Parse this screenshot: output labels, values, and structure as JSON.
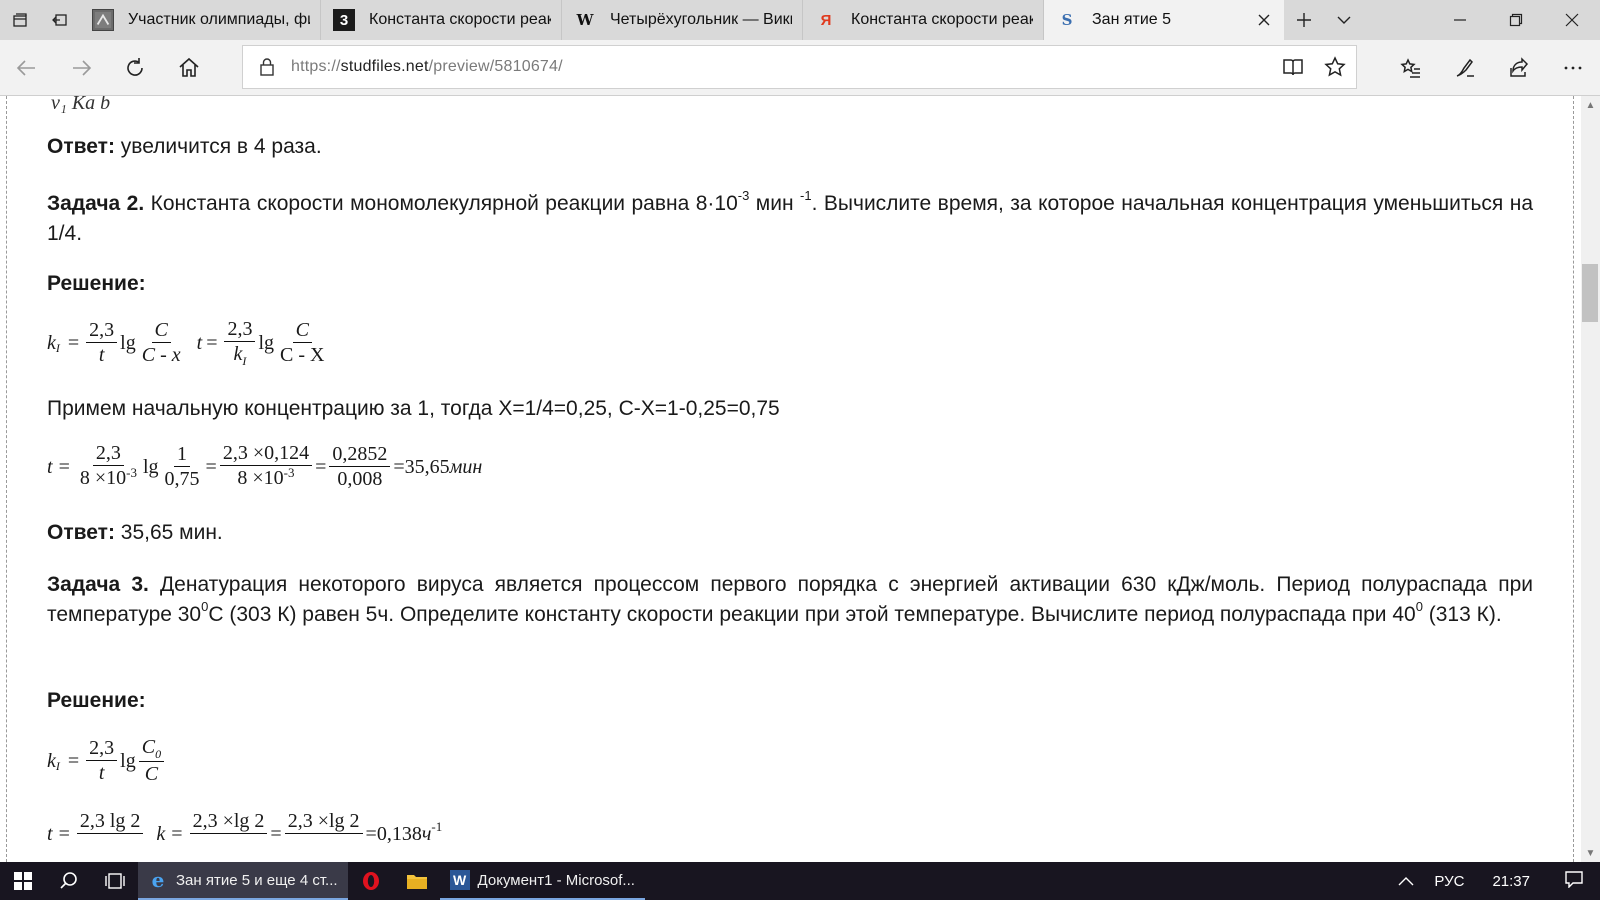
{
  "tabs": [
    {
      "title": "Участник олимпиады, фи",
      "icon": "olympiad-favicon-icon"
    },
    {
      "title": "Константа скорости реакі",
      "icon": "three-favicon-icon",
      "favicon_text": "3"
    },
    {
      "title": "Четырёхугольник — Вики",
      "icon": "wikipedia-favicon-icon",
      "favicon_text": "W"
    },
    {
      "title": "Константа скорости реакі",
      "icon": "yandex-favicon-icon",
      "favicon_text": "Я"
    },
    {
      "title": "Зан ятие 5",
      "icon": "studfiles-favicon-icon",
      "favicon_text": "S"
    }
  ],
  "address": {
    "scheme": "https://",
    "host": "studfiles.net",
    "path": "/preview/5810674/"
  },
  "doc": {
    "top_formula_fragment": "v₁      Ka  b",
    "answer1_label": "Ответ:",
    "answer1_text": " увеличится в 4 раза.",
    "task2_label": "Задача 2.",
    "task2_text_a": " Константа скорости мономолекулярной реакции равна 8·10",
    "task2_exp1": "-3",
    "task2_text_b": " мин ",
    "task2_exp2": "-1",
    "task2_text_c": ". Вычислите время, за которое начальная концентрация уменьшиться на 1/4.",
    "solution_label": "Решение:",
    "f1": {
      "k": "k",
      "k_sub": "I",
      "eq": "=",
      "num1": "2,3",
      "den1": "t",
      "lg": "lg",
      "num2": "C",
      "den2": "C - x",
      "t": "t",
      "eq2": "=",
      "num3": "2,3",
      "den3_k": "k",
      "den3_sub": "I",
      "lg2": "lg",
      "num4": "C",
      "den4": "C - X"
    },
    "assume_text": "Примем начальную концентрацию за 1, тогда Х=1/4=0,25, С-Х=1-0,25=0,75",
    "f2": {
      "t": "t",
      "eq": "=",
      "n1": "2,3",
      "d1": "8 ×10",
      "d1_exp": "-3",
      "lg": "lg",
      "n2": "1",
      "d2": "0,75",
      "eq2": "=",
      "n3": "2,3 ×0,124",
      "d3": "8 ×10",
      "d3_exp": "-3",
      "eq3": "=",
      "n4": "0,2852",
      "d4": "0,008",
      "result": "=35,65",
      "unit": "мин"
    },
    "answer2_label": "Ответ:",
    "answer2_text": " 35,65 мин.",
    "task3_label": "Задача 3.",
    "task3_text_a": " Денатурация некоторого вируса является процессом первого порядка с энергией активации 630 кДж/моль. Период полураспада при температуре 30",
    "task3_deg1": "0",
    "task3_text_b": "С (303 К) равен 5ч. Определите константу скорости реакции при этой температуре. Вычислите период полураспада при 40",
    "task3_deg2": "0",
    "task3_text_c": " (313 К).",
    "solution3_label": "Решение:",
    "f3": {
      "k": "k",
      "k_sub": "I",
      "eq": "=",
      "n1": "2,3",
      "d1": "t",
      "lg": "lg",
      "n2": "C",
      "n2_sub": "0",
      "d2": "C"
    },
    "f4": {
      "t": "t",
      "eq": "=",
      "n1": "2,3 lg 2",
      "k": "k",
      "eq2": "=",
      "n2": "2,3 ×lg 2",
      "eq3": "=",
      "n3": "2,3 ×lg 2",
      "result": "=0,138",
      "unit": "ч",
      "unit_exp": "-1"
    }
  },
  "taskbar": {
    "edge_task": "Зан ятие 5 и еще 4 ст...",
    "word_task": "Документ1 - Microsof...",
    "language": "РУС",
    "time": "21:37"
  }
}
